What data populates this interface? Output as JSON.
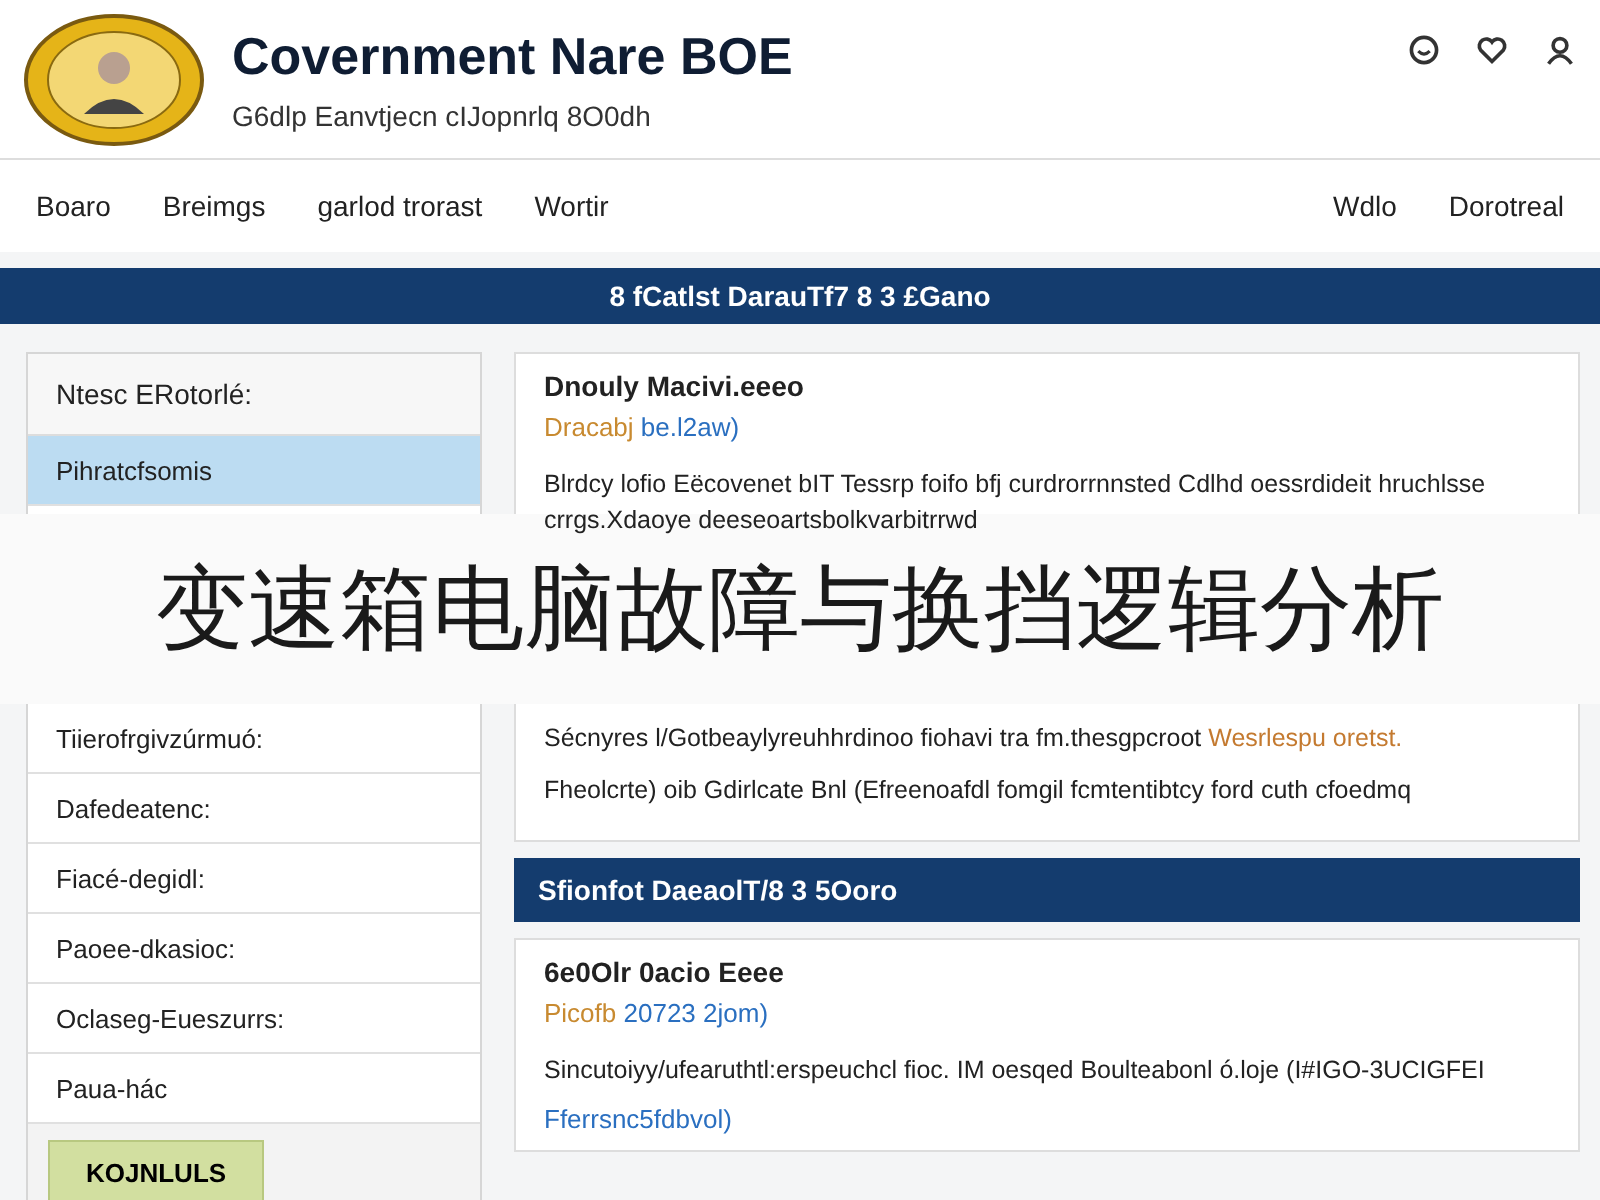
{
  "header": {
    "title": "Covernment Nare BOE",
    "subtitle": "G6dlp Eanvtjecn cIJopnrlq 8O0dh"
  },
  "nav": {
    "left": [
      "Boaro",
      "Breimgs",
      "garlod trorast",
      "Wortir"
    ],
    "right": [
      "Wdlo",
      "Dorotreal"
    ]
  },
  "banner": {
    "title": "8 fCatlst DarauTf7 8 3 £Gano"
  },
  "sidebar": {
    "heading": "Ntesc ERotorlé:",
    "items_top": [
      {
        "label": "Pihratcfsomis",
        "selected": true
      }
    ],
    "items_bottom": [
      {
        "label": "Tiierofrgivzúrmuó:",
        "selected": false
      },
      {
        "label": "Dafedeatenc:",
        "selected": false
      },
      {
        "label": "Fiacé-degidl:",
        "selected": false
      },
      {
        "label": "Paoee-dkasioc:",
        "selected": false
      },
      {
        "label": "Oclaseg-Eueszurrs:",
        "selected": false
      },
      {
        "label": "Paua-hác",
        "selected": false
      }
    ],
    "button": "KOJNLULS"
  },
  "post": {
    "title": "Dnouly Macivi.eeeo",
    "date": "Dracabj",
    "link": "be.l2aw)",
    "text": "Blrdcy lofio Eëcovenet bIT Tessrp foifo bfj curdrorrnnsted Cdlhd oessrdideit hruchlsse crrgs.Xdaoye deeseoartsbolkvarbitrrwd",
    "notes": [
      {
        "text": "Sécnyres l/Gotbeaylyreuhhrdinoo fiohavi tra fm.thesgpcroot",
        "tail": "Wesrlespu oretst."
      },
      {
        "text": "Fheolcrte) oib Gdirlcate Bnl (Efreenoafdl fomgil fcmtentibtcy ford",
        "tail": "cuth cfoedmq"
      }
    ]
  },
  "section": {
    "heading": "Sfionfot DaeaolT/8 3 5Ooro",
    "title": "6e0Olr 0acio Eeee",
    "date": "Picofb",
    "link": "20723 2jom)",
    "text": "Sincutoiyy/ufearuthtl:erspeuchcl fioc. IM oesqed Boulteabonl ó.loje (I#IGO-3UCIGFEI",
    "more": "Fferrsnc5fdbvol)"
  },
  "overlay": {
    "caption": "变速箱电脑故障与换挡逻辑分析"
  }
}
